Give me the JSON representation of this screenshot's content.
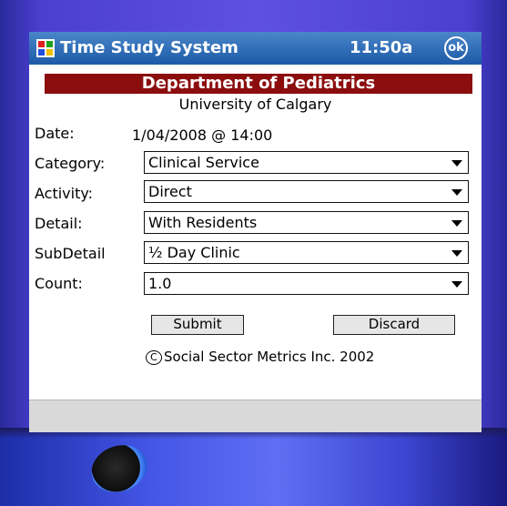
{
  "titlebar": {
    "title": "Time Study System",
    "clock": "11:50a",
    "ok_label": "ok"
  },
  "header": {
    "department": "Department of Pediatrics",
    "university": "University of Calgary"
  },
  "form": {
    "date": {
      "label": "Date:",
      "value": "1/04/2008 @ 14:00"
    },
    "category": {
      "label": "Category:",
      "value": "Clinical Service"
    },
    "activity": {
      "label": "Activity:",
      "value": "Direct"
    },
    "detail": {
      "label": "Detail:",
      "value": "With Residents"
    },
    "subdetail": {
      "label": "SubDetail",
      "value": "½ Day Clinic"
    },
    "count": {
      "label": "Count:",
      "value": "1.0"
    }
  },
  "buttons": {
    "submit": "Submit",
    "discard": "Discard"
  },
  "footer": {
    "copyright_symbol": "C",
    "copyright": "Social Sector Metrics Inc. 2002"
  },
  "colors": {
    "titlebar": "#1c5aa8",
    "department_banner": "#8b0d0d",
    "device_body": "#4b3fd0"
  },
  "icons": {
    "app": "windows-flag-icon",
    "dropdown": "chevron-down-icon"
  }
}
